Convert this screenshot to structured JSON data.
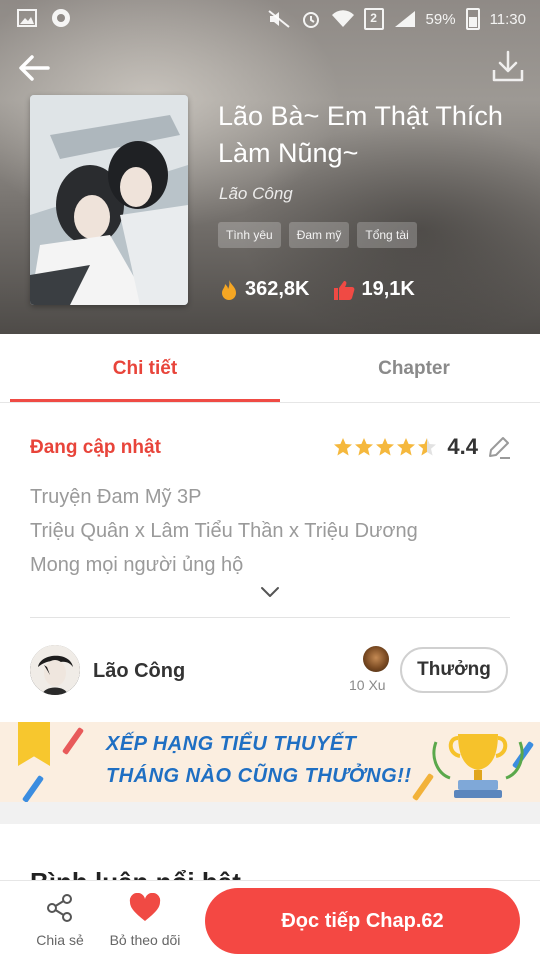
{
  "status_bar": {
    "time": "11:30",
    "battery": "59%",
    "sim_slot": "2"
  },
  "header": {
    "back_icon": "arrow-left-icon",
    "download_icon": "download-icon"
  },
  "book": {
    "title": "Lão Bà~ Em Thật Thích Làm Nũng~",
    "author": "Lão Công",
    "tags": [
      "Tình yêu",
      "Đam mỹ",
      "Tổng tài"
    ],
    "views": "362,8K",
    "likes": "19,1K"
  },
  "tabs": {
    "detail": "Chi tiết",
    "chapter": "Chapter"
  },
  "detail": {
    "status": "Đang cập nhật",
    "rating": "4.4",
    "stars": 4.4,
    "description": [
      "Truyện Đam Mỹ 3P",
      "Triệu Quân x Lâm Tiểu Thần x Triệu Dương",
      "Mong mọi người ủng hộ"
    ]
  },
  "author_row": {
    "name": "Lão Công",
    "gift_amount": "10 Xu",
    "reward_label": "Thưởng"
  },
  "banner": {
    "line1": "XẾP HẠNG TIỂU THUYẾT",
    "line2": "THÁNG NÀO CŨNG THƯỞNG!!"
  },
  "section_peek": "Bình luận nổi bật",
  "bottom_bar": {
    "share_label": "Chia sẻ",
    "unfollow_label": "Bỏ theo dõi",
    "read_label": "Đọc tiếp Chap.62"
  },
  "colors": {
    "accent": "#f44843",
    "accent_text": "#e8443a",
    "star": "#f5b83d",
    "banner_text": "#1f6fc3"
  }
}
